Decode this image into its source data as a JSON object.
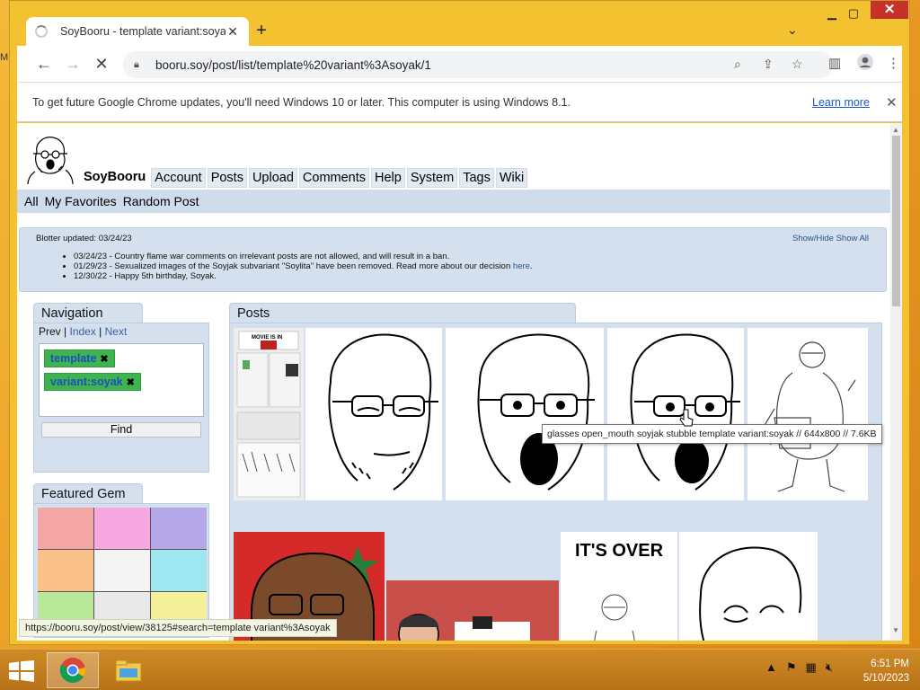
{
  "browser": {
    "tab_title": "SoyBooru - template variant:soyak",
    "url": "booru.soy/post/list/template%20variant%3Asoyak/1",
    "infobar_text": "To get future Google Chrome updates, you'll need Windows 10 or later. This computer is using Windows 8.1.",
    "infobar_link": "Learn more"
  },
  "site": {
    "brand": "SoyBooru",
    "top_nav": [
      "Account",
      "Posts",
      "Upload",
      "Comments",
      "Help",
      "System",
      "Tags",
      "Wiki"
    ],
    "sub_nav": [
      "All",
      "My Favorites",
      "Random Post"
    ],
    "blotter": {
      "updated": "Blotter updated: 03/24/23",
      "show_hide": "Show/Hide",
      "show_all": "Show All",
      "entries": [
        "03/24/23 - Country flame war comments on irrelevant posts are not allowed, and will result in a ban.",
        "01/29/23 - Sexualized images of the Soyjak subvariant \"Soylita\" have been removed. Read more about our decision ",
        "12/30/22 - Happy 5th birthday, Soyak."
      ],
      "entry_link": "here",
      "entry_link_suffix": "."
    },
    "navigation": {
      "title": "Navigation",
      "prev": "Prev",
      "index": "Index",
      "next": "Next",
      "tags": [
        "template",
        "variant:soyak"
      ],
      "find": "Find"
    },
    "featured": {
      "title": "Featured Gem"
    },
    "posts": {
      "title": "Posts",
      "tooltip": "glasses open_mouth soyjak stubble template variant:soyak // 644x800 // 7.6KB",
      "over_text": "IT'S OVER",
      "movie_text": "MOVIE IS IN"
    },
    "status_url": "https://booru.soy/post/view/38125#search=template variant%3Asoyak"
  },
  "taskbar": {
    "time": "6:51 PM",
    "date": "5/10/2023"
  },
  "desktop_label": "M"
}
